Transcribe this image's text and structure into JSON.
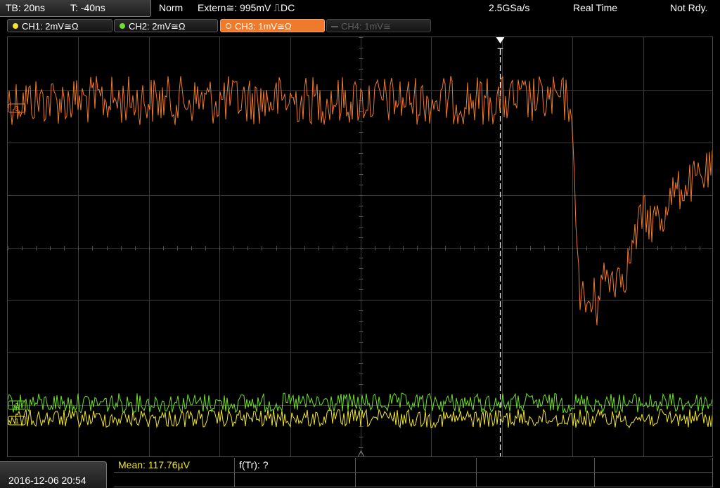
{
  "header": {
    "timebase": "TB: 20ns",
    "trigger_time": "T: -40ns",
    "trigger_mode": "Norm",
    "trigger_source": "Extern≅: 995mV ⎍DC",
    "sample_rate": "2.5GSa/s",
    "acq_mode": "Real Time",
    "status": "Not Rdy."
  },
  "channels": [
    {
      "label": "CH1: 2mV≅Ω",
      "color": "#f2e72e",
      "state": "on"
    },
    {
      "label": "CH2: 2mV≅Ω",
      "color": "#6ee02b",
      "state": "on"
    },
    {
      "label": "CH3: 1mV≅Ω",
      "color": "#f07a2c",
      "state": "active"
    },
    {
      "label": "CH4: 1mV≅",
      "color": "#5d5d5d",
      "state": "off"
    }
  ],
  "markers": {
    "trigger": "T",
    "ch3": "3",
    "ch2": "2",
    "ch1": "1"
  },
  "footer": {
    "datetime": "2016-12-06 20:54",
    "measurements": [
      {
        "label": "Mean: 117.76µV",
        "color": "#f2e72e"
      },
      {
        "label": "f(Tr): ?",
        "color": "#ffffff"
      }
    ]
  },
  "colors": {
    "grid": "#3a3a3a",
    "ch1": "#f2e72e",
    "ch2": "#6ee02b",
    "ch3": "#f07a2c",
    "trigger_line": "#ffffff"
  }
}
